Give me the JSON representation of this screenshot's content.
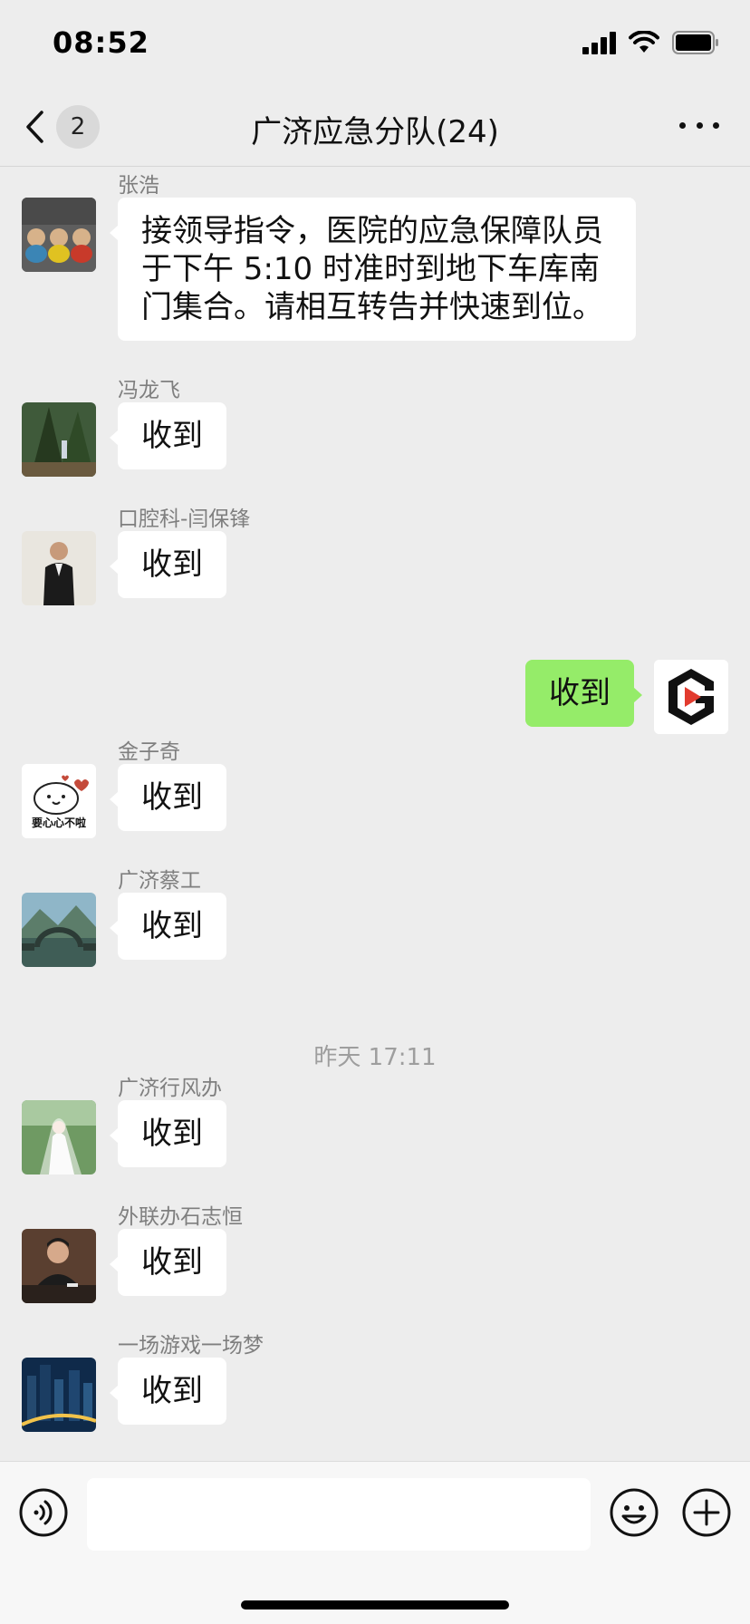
{
  "status_bar": {
    "time": "08:52"
  },
  "nav": {
    "back_count": "2",
    "title": "广济应急分队(24)"
  },
  "messages": [
    {
      "sender": "张浩",
      "text": "接领导指令，医院的应急保障队员于下午 5:10 时准时到地下车库南门集合。请相互转告并快速到位。",
      "avatar": "teddy-bears-avatar"
    },
    {
      "sender": "冯龙飞",
      "text": "收到",
      "avatar": "forest-hiker-avatar"
    },
    {
      "sender": "口腔科-闫保锋",
      "text": "收到",
      "avatar": "man-in-suit-avatar"
    },
    {
      "sender": "",
      "text": "收到",
      "avatar": "g-logo-avatar",
      "self": true
    },
    {
      "sender": "金子奇",
      "text": "收到",
      "avatar": "cartoon-bun-avatar",
      "avatar_caption": "要心心不啦"
    },
    {
      "sender": "广济蔡工",
      "text": "收到",
      "avatar": "stone-bridge-avatar"
    }
  ],
  "timestamp": "昨天 17:11",
  "messages_after": [
    {
      "sender": "广济行风办",
      "text": "收到",
      "avatar": "bride-avatar"
    },
    {
      "sender": "外联办石志恒",
      "text": "收到",
      "avatar": "man-at-table-avatar"
    },
    {
      "sender": "一场游戏一场梦",
      "text": "收到",
      "avatar": "night-city-avatar"
    }
  ],
  "input": {
    "placeholder": ""
  },
  "colors": {
    "background": "#ededed",
    "self_bubble": "#95ec69",
    "other_bubble": "#ffffff"
  }
}
